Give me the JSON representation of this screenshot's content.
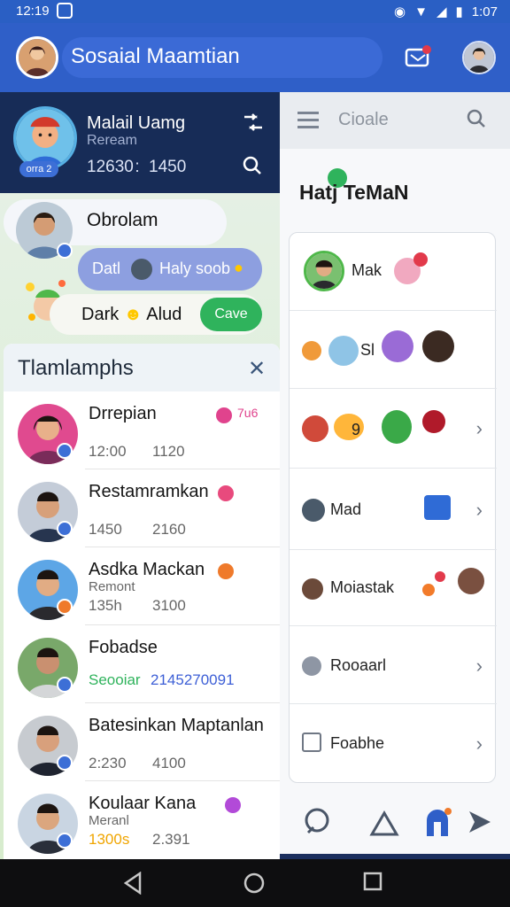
{
  "status": {
    "time": "12:19",
    "right_time": "1:07"
  },
  "appbar": {
    "title": "Sosaial Maamtian"
  },
  "profile": {
    "name": "Malail Uamg",
    "subtitle": "Reream",
    "badge": "orra 2",
    "stat_a": "12630 :",
    "stat_b": "1450"
  },
  "chat": {
    "bubble1": "Obrolam",
    "bubble2_left": "Datl",
    "bubble2_right": "Haly soob",
    "bubble3": "Dark",
    "bubble3_b": "Alud",
    "save_label": "Cave"
  },
  "list": {
    "title": "Tlamlamphs",
    "close": "✕",
    "rows": [
      {
        "name": "Drrepian",
        "a": "12:00",
        "b": "1120",
        "tag_text": "7u6",
        "tag_color": "#e0438d"
      },
      {
        "name": "Restamramkan",
        "a": "1450",
        "b": "2160",
        "tag_color": "#e84a7d"
      },
      {
        "name": "Asdka Mackan",
        "sub": "Remont",
        "a": "135h",
        "b": "3100",
        "tag_color": "#ef7a2b"
      },
      {
        "name": "Fobadse",
        "a": "Seooiar",
        "b": "2145270091",
        "a_color": "#2fb35c",
        "b_color": "#3d5fd6"
      },
      {
        "name": "Batesinkan Maptanlan",
        "a": "2:230",
        "b": "4100"
      },
      {
        "name": "Koulaar Kana",
        "sub": "Meranl",
        "a": "1300s",
        "b": "2.391",
        "a_color": "#f0a500",
        "tag_color": "#b24ad8"
      }
    ]
  },
  "right": {
    "search_placeholder": "Cioale",
    "title": "Hatj TeMaN",
    "items": [
      {
        "label": "Mak"
      },
      {
        "label": "Sl"
      },
      {
        "label": "9"
      },
      {
        "label": "Mad"
      },
      {
        "label": "Moiastak"
      },
      {
        "label": "Rooaarl"
      },
      {
        "label": "Foabhe"
      }
    ]
  },
  "colors": {
    "primary": "#2f5fc8",
    "dark": "#172c57",
    "green": "#2fb35c"
  }
}
